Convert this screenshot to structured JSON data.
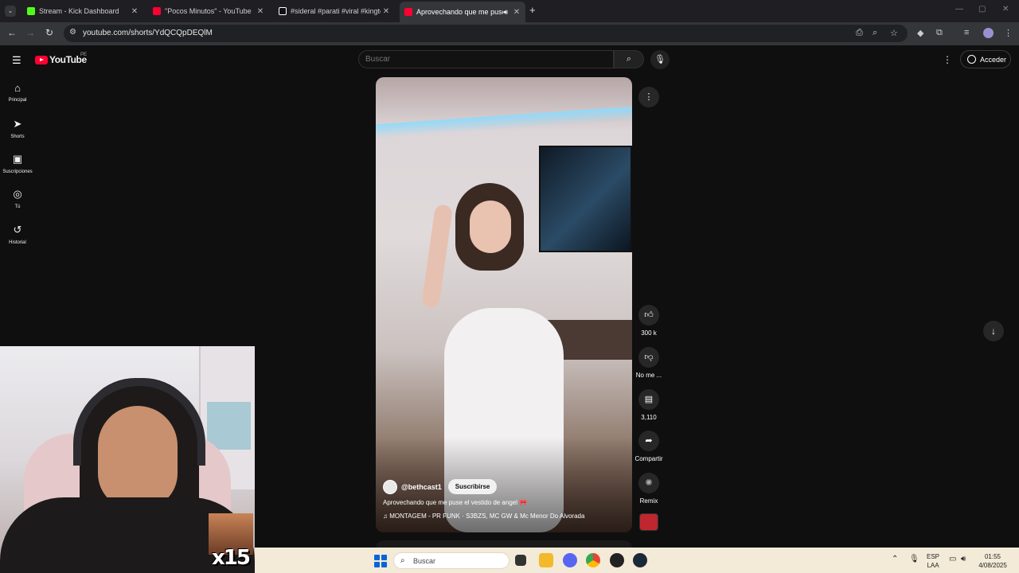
{
  "browser": {
    "tabs": [
      {
        "title": "Stream - Kick Dashboard",
        "color": "#53fc18",
        "active": false
      },
      {
        "title": "\"Pocos Minutos\" - YouTube",
        "color": "#ff0033",
        "active": false
      },
      {
        "title": "#sideral #parati #viral #kingteka",
        "color": "#111111",
        "active": false
      },
      {
        "title": "Aprovechando que me puse",
        "color": "#ff0033",
        "active": true
      }
    ],
    "new_tab": "+",
    "url": "youtube.com/shorts/YdQCQpDEQlM"
  },
  "youtube": {
    "logo_text": "YouTube",
    "country_code": "PE",
    "search_placeholder": "Buscar",
    "signin_label": "Acceder",
    "nav": [
      {
        "icon": "home-icon",
        "label": "Principal"
      },
      {
        "icon": "shorts-icon",
        "label": "Shorts"
      },
      {
        "icon": "subscriptions-icon",
        "label": "Suscripciones"
      },
      {
        "icon": "you-icon",
        "label": "Tú"
      },
      {
        "icon": "history-icon",
        "label": "Historial"
      }
    ],
    "short": {
      "channel": "@bethcast1",
      "subscribe_label": "Suscribirse",
      "caption": "Aprovechando que me puse el vestido de angel 🎀",
      "music": "♫ MONTAGEM - PR FUNK · S3BZS, MC GW & Mc Menor Do Alvorada"
    },
    "actions": {
      "likes": "300 k",
      "dislike": "No me ...",
      "comments": "3,110",
      "share": "Compartir",
      "remix": "Remix"
    }
  },
  "overlay": {
    "meme_text": "x15"
  },
  "taskbar": {
    "search_placeholder": "Buscar",
    "lang_top": "ESP",
    "lang_bottom": "LAA",
    "time": "01:55",
    "date": "4/08/2025"
  }
}
